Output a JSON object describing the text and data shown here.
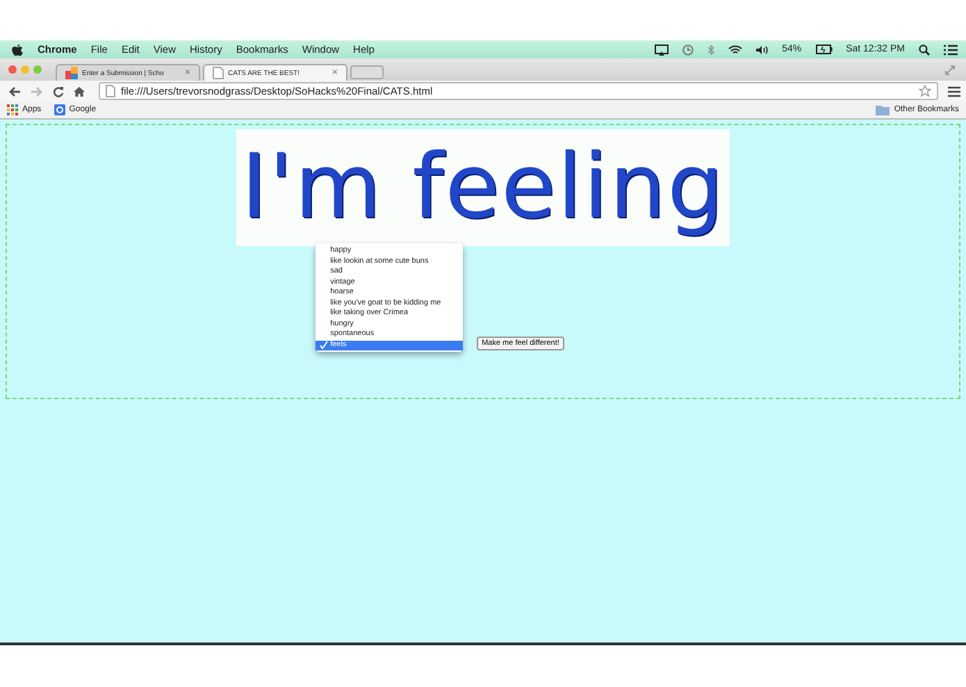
{
  "menu_bar": {
    "app": "Chrome",
    "items": [
      "File",
      "Edit",
      "View",
      "History",
      "Bookmarks",
      "Window",
      "Help"
    ],
    "battery": "54%",
    "clock": "Sat 12:32 PM"
  },
  "tabs": [
    {
      "title": "Enter a Submission | Scho",
      "close": "×",
      "selected": false
    },
    {
      "title": "CATS ARE THE BEST!",
      "close": "×",
      "selected": true
    }
  ],
  "address_bar": {
    "value": "file:///Users/trevorsnodgrass/Desktop/SoHacks%20Final/CATS.html"
  },
  "bookmarks": {
    "items": [
      "Apps",
      "Google"
    ],
    "other": "Other Bookmarks"
  },
  "page": {
    "heading": "I'm feeling",
    "options": [
      {
        "label": "happy",
        "selected": false
      },
      {
        "label": "like lookin at some cute buns",
        "selected": false
      },
      {
        "label": "sad",
        "selected": false
      },
      {
        "label": "vintage",
        "selected": false
      },
      {
        "label": "hoarse",
        "selected": false
      },
      {
        "label": "like you've goat to be kidding me",
        "selected": false
      },
      {
        "label": "like taking over Crimea",
        "selected": false
      },
      {
        "label": "hungry",
        "selected": false
      },
      {
        "label": "spontaneous",
        "selected": false
      },
      {
        "label": "feels",
        "selected": true
      }
    ],
    "button": "Make me feel different!"
  }
}
